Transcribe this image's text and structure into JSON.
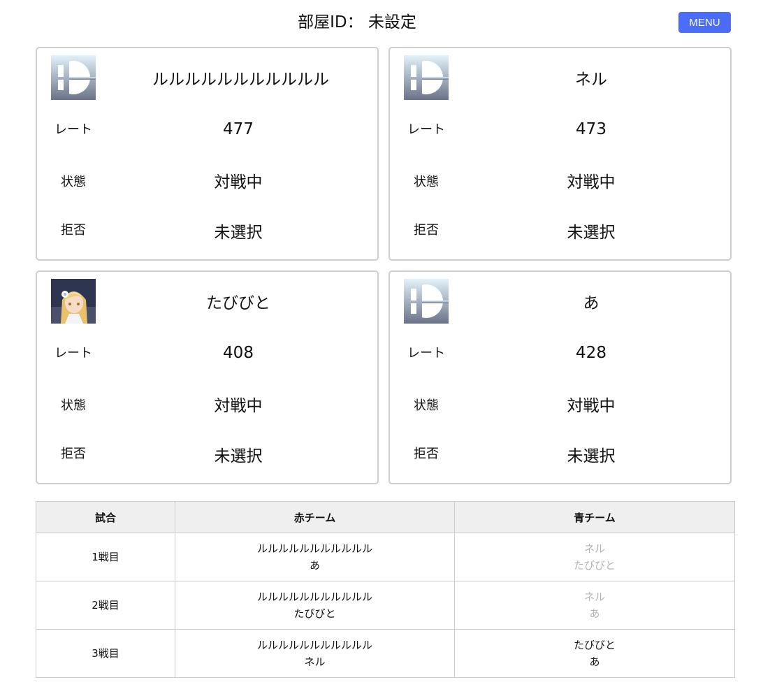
{
  "header": {
    "room_title": "部屋ID： 未設定",
    "menu_label": "MENU"
  },
  "labels": {
    "rate": "レート",
    "state": "状態",
    "refuse": "拒否"
  },
  "players": [
    {
      "name": "ルルルルルルルルルルル",
      "avatar": "smash-bros-logo-icon",
      "rate": "477",
      "state": "対戦中",
      "refuse": "未選択"
    },
    {
      "name": "ネル",
      "avatar": "smash-bros-logo-icon",
      "rate": "473",
      "state": "対戦中",
      "refuse": "未選択"
    },
    {
      "name": "たびびと",
      "avatar": "anime-character-avatar",
      "rate": "408",
      "state": "対戦中",
      "refuse": "未選択"
    },
    {
      "name": "あ",
      "avatar": "smash-bros-logo-icon",
      "rate": "428",
      "state": "対戦中",
      "refuse": "未選択"
    }
  ],
  "table": {
    "headers": [
      "試合",
      "赤チーム",
      "青チーム"
    ],
    "rows": [
      {
        "match": "1戦目",
        "red": [
          "ルルルルルルルルルルル",
          "あ"
        ],
        "blue": [
          "ネル",
          "たびびと"
        ],
        "blue_dimmed": true
      },
      {
        "match": "2戦目",
        "red": [
          "ルルルルルルルルルルル",
          "たびびと"
        ],
        "blue": [
          "ネル",
          "あ"
        ],
        "blue_dimmed": true
      },
      {
        "match": "3戦目",
        "red": [
          "ルルルルルルルルルルル",
          "ネル"
        ],
        "blue": [
          "たびびと",
          "あ"
        ],
        "blue_dimmed": false
      }
    ]
  },
  "colors": {
    "menu_button": "#4a6cf7",
    "card_border": "#cfcfcf",
    "header_bg": "#efefef",
    "dimmed_text": "#b3b3b3"
  }
}
